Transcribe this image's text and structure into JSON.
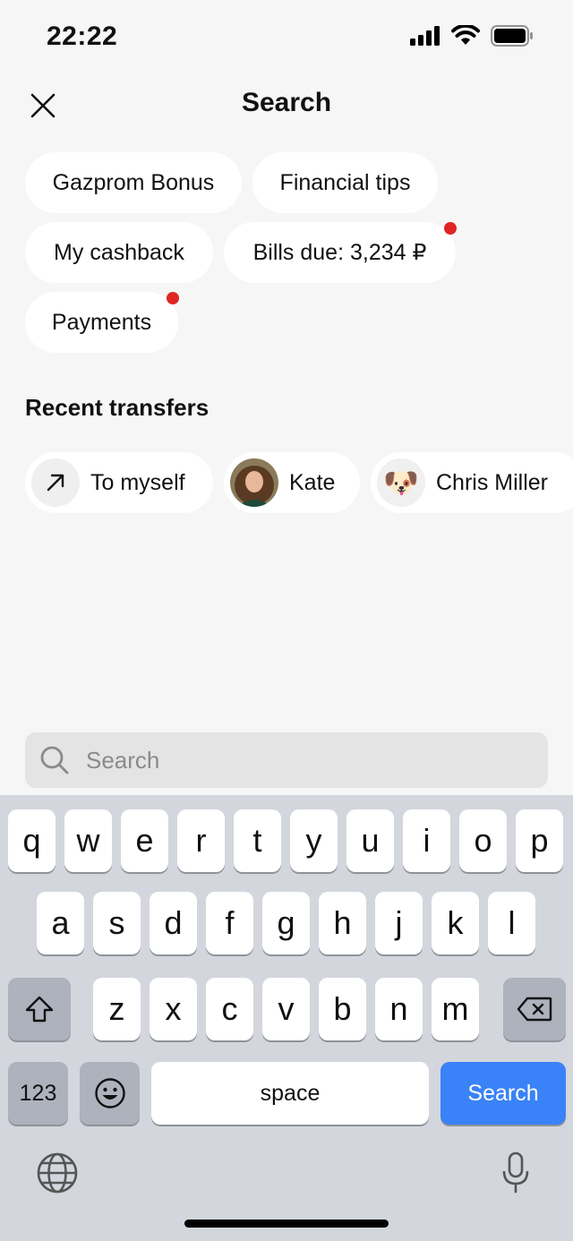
{
  "status_bar": {
    "time": "22:22"
  },
  "header": {
    "title": "Search"
  },
  "chips": [
    {
      "label": "Gazprom Bonus",
      "dot": false
    },
    {
      "label": "Financial tips",
      "dot": false
    },
    {
      "label": "My cashback",
      "dot": false
    },
    {
      "label": "Bills due: 3,234 ₽",
      "dot": true
    },
    {
      "label": "Payments",
      "dot": true
    }
  ],
  "recent": {
    "title": "Recent transfers",
    "items": [
      {
        "label": "To myself",
        "icon": "arrow-up-right-icon"
      },
      {
        "label": "Kate",
        "icon": "avatar-photo"
      },
      {
        "label": "Chris Miller",
        "icon": "dog-emoji-avatar",
        "emoji": "🐶"
      }
    ]
  },
  "search": {
    "placeholder": "Search",
    "value": ""
  },
  "keyboard": {
    "row1": [
      "q",
      "w",
      "e",
      "r",
      "t",
      "y",
      "u",
      "i",
      "o",
      "p"
    ],
    "row2": [
      "a",
      "s",
      "d",
      "f",
      "g",
      "h",
      "j",
      "k",
      "l"
    ],
    "row3": [
      "z",
      "x",
      "c",
      "v",
      "b",
      "n",
      "m"
    ],
    "numbers_label": "123",
    "space_label": "space",
    "return_label": "Search"
  },
  "colors": {
    "accent": "#3a82f7",
    "notification_dot": "#e02424",
    "background": "#f6f6f6",
    "keyboard": "#d3d6dd"
  }
}
